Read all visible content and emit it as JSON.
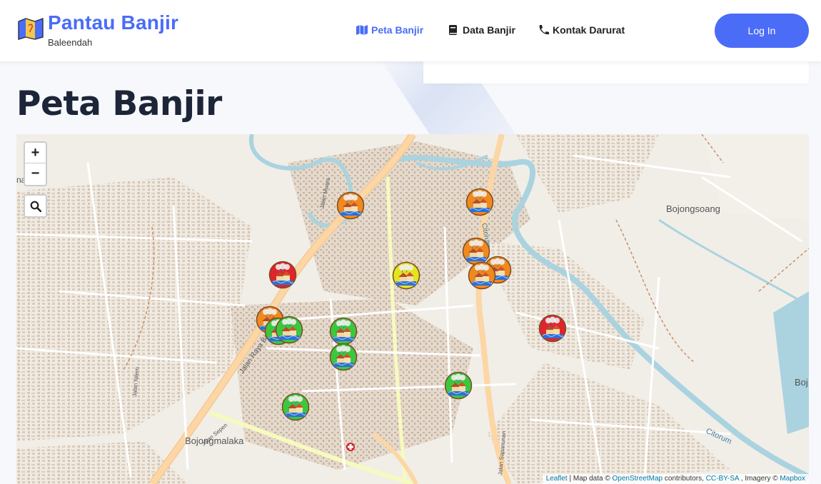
{
  "brand": {
    "title": "Pantau Banjir",
    "subtitle": "Baleendah"
  },
  "nav": {
    "map": "Peta Banjir",
    "data": "Data Banjir",
    "emergency": "Kontak Darurat"
  },
  "auth": {
    "login": "Log In"
  },
  "page": {
    "title": "Peta Banjir"
  },
  "map": {
    "zoom_in": "+",
    "zoom_out": "−",
    "labels": {
      "bojongsoang": "Bojongsoang",
      "bojongmalaka": "Bojongmalaka",
      "citorum1": "Citorum",
      "citorum2": "Citorum",
      "jalan_raya": "Jalan Raya Banjaran",
      "jalan_muara": "Jalan Muara",
      "jalan_nilem": "Jalan Nilem",
      "jalan_sepen": "Jalan Sepen",
      "jalan_sapanunan": "Jalan Sapanunan",
      "bojo": "Boj",
      "na": "na"
    },
    "attribution": {
      "leaflet": "Leaflet",
      "mapdata": "| Map data ©",
      "osm": "OpenStreetMap",
      "contrib": "contributors,",
      "ccbysa": "CC-BY-SA",
      "imagery": ", Imagery ©",
      "mapbox": "Mapbox"
    },
    "marker_levels": [
      "orange",
      "orange",
      "yellow",
      "red",
      "orange",
      "orange",
      "orange",
      "orange",
      "green",
      "green",
      "green",
      "green",
      "red",
      "green",
      "green"
    ],
    "level_colors": {
      "red": "#e0242c",
      "orange": "#f08a1c",
      "yellow": "#e4e61c",
      "green": "#3cc83c"
    }
  }
}
